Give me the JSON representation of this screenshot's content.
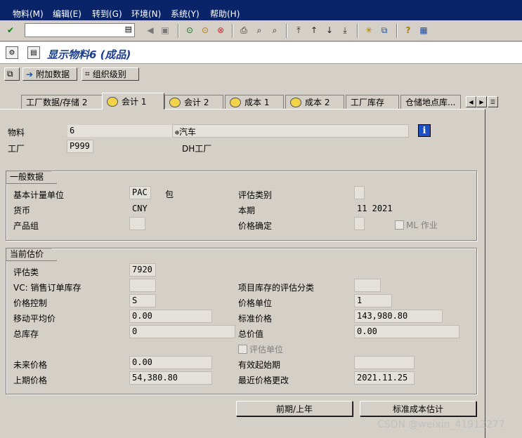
{
  "menu": [
    "物料(M)",
    "编辑(E)",
    "转到(G)",
    "环境(N)",
    "系统(Y)",
    "帮助(H)"
  ],
  "toolbar": {
    "command_value": ""
  },
  "title": {
    "text": "显示物料6 (成品)"
  },
  "app_buttons": {
    "additional_data": "附加数据",
    "org_levels": "组织级别"
  },
  "tabs": [
    {
      "label": "工厂数据/存储 2",
      "icon": false,
      "active": false
    },
    {
      "label": "会计 1",
      "icon": true,
      "active": true
    },
    {
      "label": "会计 2",
      "icon": true,
      "active": false
    },
    {
      "label": "成本 1",
      "icon": true,
      "active": false
    },
    {
      "label": "成本 2",
      "icon": true,
      "active": false
    },
    {
      "label": "工厂库存",
      "icon": false,
      "active": false
    },
    {
      "label": "仓储地点库...",
      "icon": false,
      "active": false
    }
  ],
  "header": {
    "material_label": "物料",
    "material_value": "6",
    "material_desc": "汽车",
    "plant_label": "工厂",
    "plant_value": "P999",
    "plant_desc": "DH工厂"
  },
  "general": {
    "title": "一般数据",
    "base_uom_label": "基本计量单位",
    "base_uom_value": "PAC",
    "base_uom_desc": "包",
    "valuation_cat_label": "评估类别",
    "valuation_cat_value": "",
    "currency_label": "货币",
    "currency_value": "CNY",
    "period_label": "本期",
    "period_value": "11 2021",
    "product_group_label": "产品组",
    "product_group_value": "",
    "price_det_label": "价格确定",
    "price_det_value": "",
    "ml_label": "ML 作业"
  },
  "valuation": {
    "title": "当前估价",
    "val_class_label": "评估类",
    "val_class_value": "7920",
    "vc_label": "VC: 销售订单库存",
    "vc_value": "",
    "proj_stock_label": "项目库存的评估分类",
    "proj_stock_value": "",
    "price_ctrl_label": "价格控制",
    "price_ctrl_value": "S",
    "price_unit_label": "价格单位",
    "price_unit_value": "1",
    "map_label": "移动平均价",
    "map_value": "0.00",
    "std_price_label": "标准价格",
    "std_price_value": "143,980.80",
    "total_stock_label": "总库存",
    "total_stock_value": "0",
    "total_value_label": "总价值",
    "total_value_value": "0.00",
    "val_unit_label": "评估单位",
    "future_price_label": "未来价格",
    "future_price_value": "0.00",
    "valid_from_label": "有效起始期",
    "valid_from_value": "",
    "prev_price_label": "上期价格",
    "prev_price_value": "54,380.80",
    "last_change_label": "最近价格更改",
    "last_change_value": "2021.11.25"
  },
  "buttons": {
    "prev_period": "前期/上年",
    "std_cost_est": "标准成本估计"
  },
  "watermark": "CSDN @weixin_41912277",
  "colors": {
    "menubar_bg": "#0a246a",
    "title_color": "#1c3e8c",
    "panel_bg": "#d4d0c8",
    "info_blue": "#1e4fc3"
  }
}
